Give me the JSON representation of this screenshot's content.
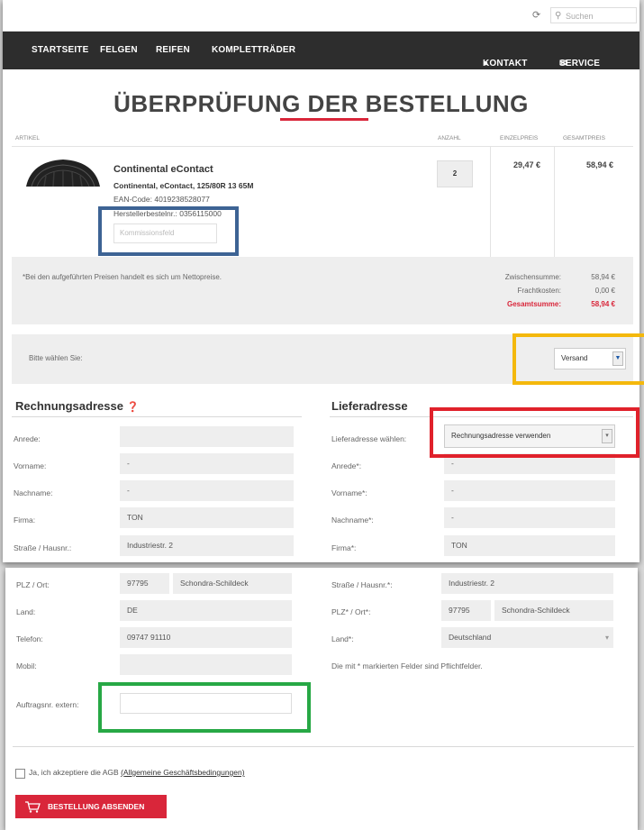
{
  "topbar": {
    "search_placeholder": "Suchen"
  },
  "nav": {
    "items": [
      "STARTSEITE",
      "FELGEN",
      "REIFEN",
      "KOMPLETTRÄDER"
    ],
    "contact": "KONTAKT",
    "service": "SERVICE"
  },
  "page_title": "ÜBERPRÜFUNG DER BESTELLUNG",
  "table": {
    "headers": {
      "article": "ARTIKEL",
      "qty": "ANZAHL",
      "unit": "EINZELPREIS",
      "total": "GESAMTPREIS"
    },
    "item": {
      "name": "Continental eContact",
      "subtitle": "Continental, eContact, 125/80R 13 65M",
      "ean": "EAN-Code: 4019238528077",
      "mfr": "Herstellerbestelnr.: 0356115000",
      "komm_placeholder": "Kommissionsfeld",
      "qty": "2",
      "unit_price": "29,47 €",
      "total_price": "58,94 €"
    }
  },
  "summary": {
    "note": "*Bei den aufgeführten Preisen handelt es sich um Nettopreise.",
    "subtotal_label": "Zwischensumme:",
    "subtotal": "58,94 €",
    "freight_label": "Frachtkosten:",
    "freight": "0,00 €",
    "total_label": "Gesamtsumme:",
    "total": "58,94 €"
  },
  "shipping": {
    "label": "Bitte wählen Sie:",
    "selected": "Versand"
  },
  "billing": {
    "title": "Rechnungsadresse",
    "fields": [
      {
        "label": "Anrede:",
        "value": ""
      },
      {
        "label": "Vorname:",
        "value": "-"
      },
      {
        "label": "Nachname:",
        "value": "-"
      },
      {
        "label": "Firma:",
        "value": "TON"
      },
      {
        "label": "Straße / Hausnr.:",
        "value": "Industriestr. 2"
      }
    ],
    "fields2": [
      {
        "label": "PLZ / Ort:",
        "plz": "97795",
        "ort": "Schondra-Schildeck"
      },
      {
        "label": "Land:",
        "value": "DE"
      },
      {
        "label": "Telefon:",
        "value": "09747 91110"
      },
      {
        "label": "Mobil:",
        "value": ""
      },
      {
        "label": "Auftragsnr. extern:",
        "value": ""
      }
    ]
  },
  "delivery": {
    "title": "Lieferadresse",
    "select_label": "Lieferadresse wählen:",
    "select_value": "Rechnungsadresse verwenden",
    "fields": [
      {
        "label": "Anrede*:",
        "value": "-"
      },
      {
        "label": "Vorname*:",
        "value": "-"
      },
      {
        "label": "Nachname*:",
        "value": "-"
      },
      {
        "label": "Firma*:",
        "value": "TON"
      }
    ],
    "fields2": [
      {
        "label": "Straße / Hausnr.*:",
        "value": "Industriestr. 2"
      },
      {
        "label": "PLZ* / Ort*:",
        "plz": "97795",
        "ort": "Schondra-Schildeck"
      },
      {
        "label": "Land*:",
        "value": "Deutschland"
      }
    ],
    "required_note": "Die mit * markierten Felder sind Pflichtfelder."
  },
  "agb": {
    "prefix": "Ja, ich akzeptiere die AGB ",
    "link": "(Allgemeine Geschäftsbedingungen)"
  },
  "submit_label": "BESTELLUNG ABSENDEN",
  "colors": {
    "accent": "#d9263a",
    "nav_bg": "#2d2d2d",
    "highlight_blue": "#3d6394",
    "highlight_yellow": "#f4b80c",
    "highlight_red": "#e0212b",
    "highlight_green": "#27a845"
  }
}
